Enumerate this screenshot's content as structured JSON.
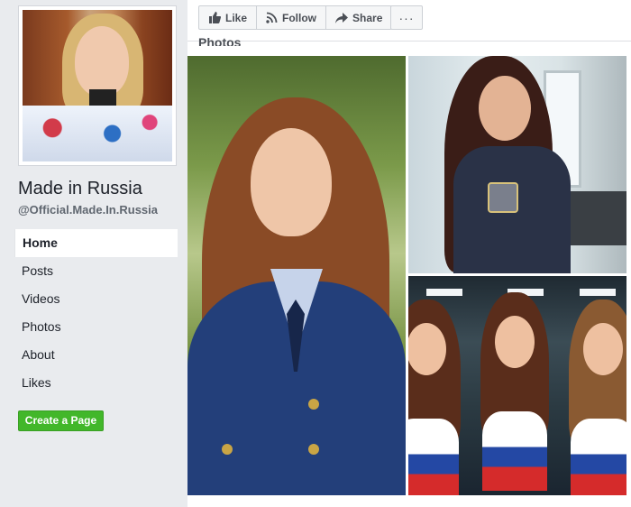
{
  "page": {
    "name": "Made in Russia",
    "handle": "@Official.Made.In.Russia"
  },
  "nav": {
    "items": [
      {
        "label": "Home",
        "active": true
      },
      {
        "label": "Posts",
        "active": false
      },
      {
        "label": "Videos",
        "active": false
      },
      {
        "label": "Photos",
        "active": false
      },
      {
        "label": "About",
        "active": false
      },
      {
        "label": "Likes",
        "active": false
      }
    ]
  },
  "create_page_label": "Create a Page",
  "actions": {
    "like_label": "Like",
    "follow_label": "Follow",
    "share_label": "Share",
    "more_label": "···"
  },
  "photos": {
    "title": "Photos"
  },
  "colors": {
    "accent_green": "#42b72a",
    "background": "#e9ebee",
    "text_secondary": "#606770"
  },
  "icons": [
    "like-icon",
    "follow-icon",
    "share-icon",
    "more-icon"
  ]
}
